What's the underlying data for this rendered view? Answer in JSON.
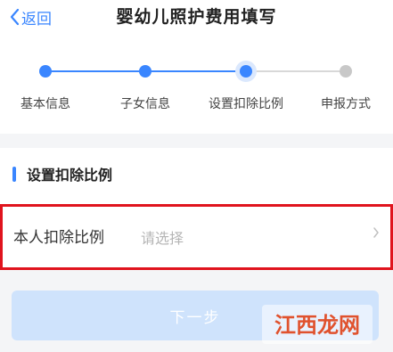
{
  "header": {
    "back_label": "返回",
    "title": "婴幼儿照护费用填写"
  },
  "stepper": {
    "steps": [
      {
        "label": "基本信息",
        "state": "done"
      },
      {
        "label": "子女信息",
        "state": "done"
      },
      {
        "label": "设置扣除比例",
        "state": "current"
      },
      {
        "label": "申报方式",
        "state": "todo"
      }
    ],
    "active_color": "#3a86ff",
    "inactive_color": "#c8c8c8"
  },
  "section": {
    "title": "设置扣除比例"
  },
  "form": {
    "ratio_label": "本人扣除比例",
    "ratio_placeholder": "请选择"
  },
  "actions": {
    "next_label": "下一步"
  },
  "watermark": {
    "text": "江西龙网"
  },
  "colors": {
    "accent": "#3a86ff",
    "highlight_border": "#e0141e",
    "button_disabled": "#cfe3fc"
  }
}
